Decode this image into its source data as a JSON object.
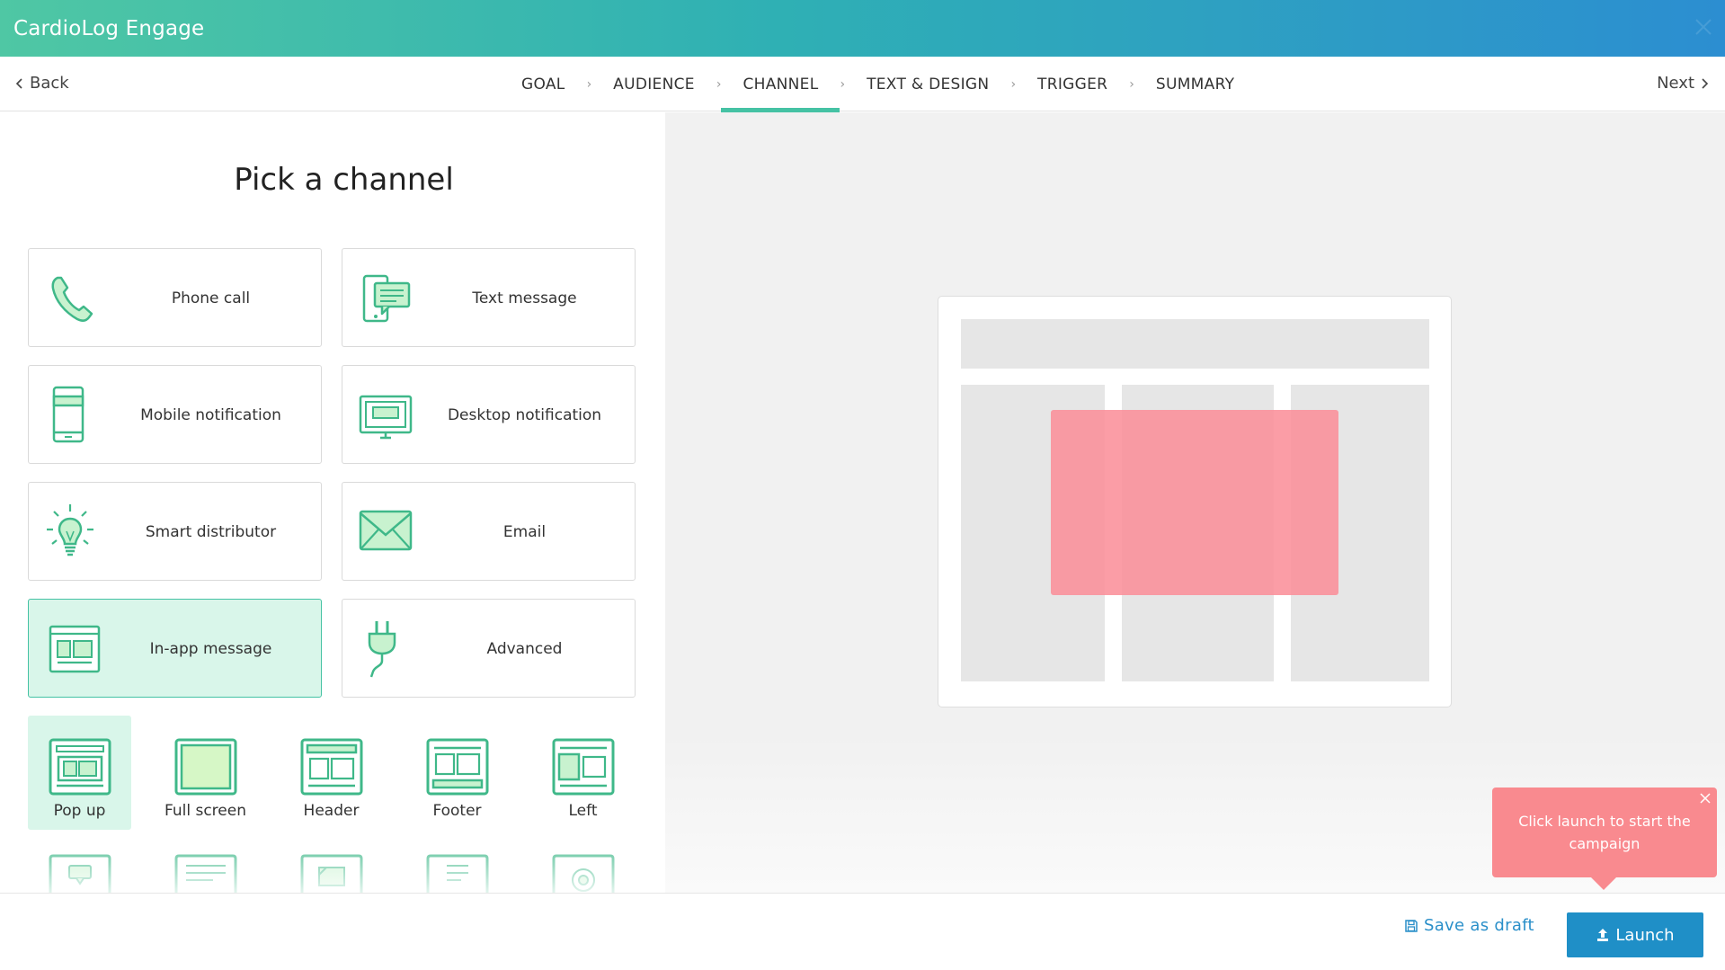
{
  "app": {
    "title": "CardioLog Engage"
  },
  "nav": {
    "back_label": "Back",
    "next_label": "Next",
    "steps": [
      {
        "label": "GOAL",
        "active": false
      },
      {
        "label": "AUDIENCE",
        "active": false
      },
      {
        "label": "CHANNEL",
        "active": true
      },
      {
        "label": "TEXT & DESIGN",
        "active": false
      },
      {
        "label": "TRIGGER",
        "active": false
      },
      {
        "label": "SUMMARY",
        "active": false
      }
    ]
  },
  "main": {
    "title": "Pick a channel",
    "channels": [
      {
        "label": "Phone call",
        "icon": "phone-icon",
        "selected": false
      },
      {
        "label": "Text message",
        "icon": "text-message-icon",
        "selected": false
      },
      {
        "label": "Mobile notification",
        "icon": "mobile-icon",
        "selected": false
      },
      {
        "label": "Desktop notification",
        "icon": "desktop-icon",
        "selected": false
      },
      {
        "label": "Smart distributor",
        "icon": "lightbulb-icon",
        "selected": false
      },
      {
        "label": "Email",
        "icon": "envelope-icon",
        "selected": false
      },
      {
        "label": "In-app message",
        "icon": "in-app-icon",
        "selected": true
      },
      {
        "label": "Advanced",
        "icon": "plug-icon",
        "selected": false
      }
    ],
    "formats": [
      {
        "label": "Pop up",
        "icon": "popup-layout-icon",
        "selected": true
      },
      {
        "label": "Full screen",
        "icon": "fullscreen-layout-icon",
        "selected": false
      },
      {
        "label": "Header",
        "icon": "header-layout-icon",
        "selected": false
      },
      {
        "label": "Footer",
        "icon": "footer-layout-icon",
        "selected": false
      },
      {
        "label": "Left",
        "icon": "left-layout-icon",
        "selected": false
      }
    ]
  },
  "footer": {
    "save_label": "Save as draft",
    "launch_label": "Launch"
  },
  "tooltip": {
    "text": "Click launch to start the campaign"
  },
  "colors": {
    "accent": "#45c2a4",
    "primary": "#1f8fc7",
    "tooltip": "#f98a8f",
    "selected_bg": "#d9f6ea"
  }
}
